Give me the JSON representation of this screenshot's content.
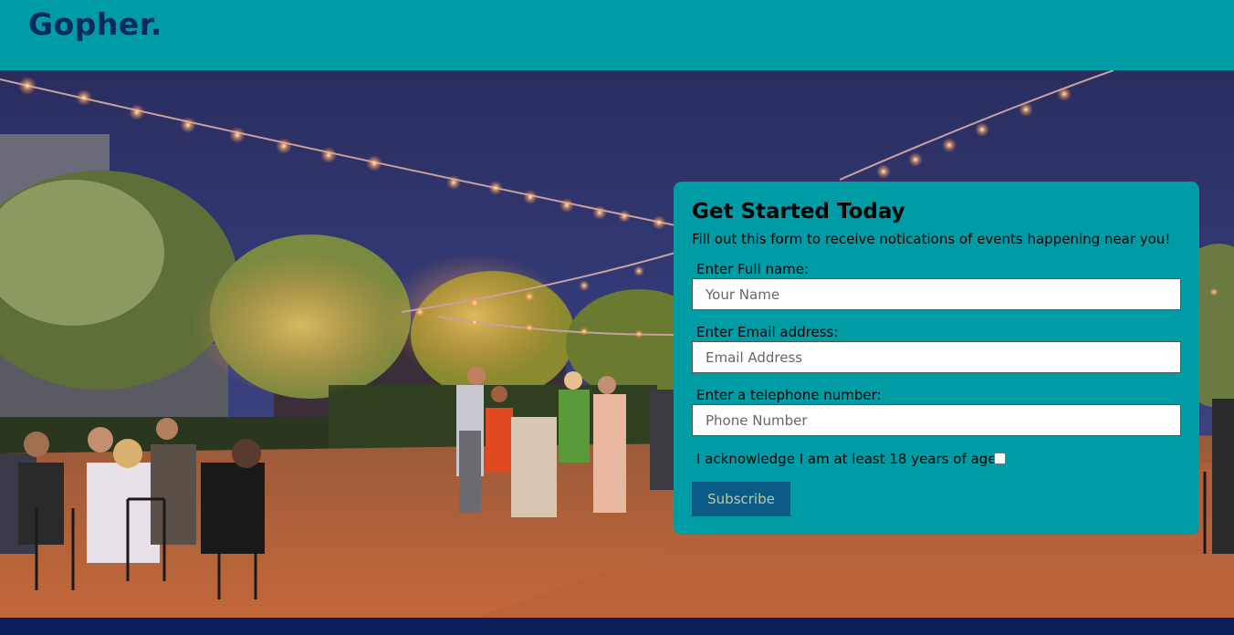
{
  "header": {
    "logo": "Gopher."
  },
  "hero": {
    "image": "photo of an outdoor evening party on a brick patio under string lights"
  },
  "form": {
    "title": "Get Started Today",
    "subtitle": "Fill out this form to receive notications of events happening near you!",
    "name_label": "Enter Full name:",
    "name_placeholder": "Your Name",
    "email_label": "Enter Email address:",
    "email_placeholder": "Email Address",
    "phone_label": "Enter a telephone number:",
    "phone_placeholder": "Phone Number",
    "ack_label": "I acknowledge I am at least 18 years of age.",
    "ack_checked": false,
    "subscribe_label": "Subscribe"
  },
  "colors": {
    "header_bg": "#009ca6",
    "logo": "#0b2a5c",
    "card_bg": "#009ca6",
    "button_bg": "#0b5b86",
    "footer_bg": "#0b1f5c"
  }
}
